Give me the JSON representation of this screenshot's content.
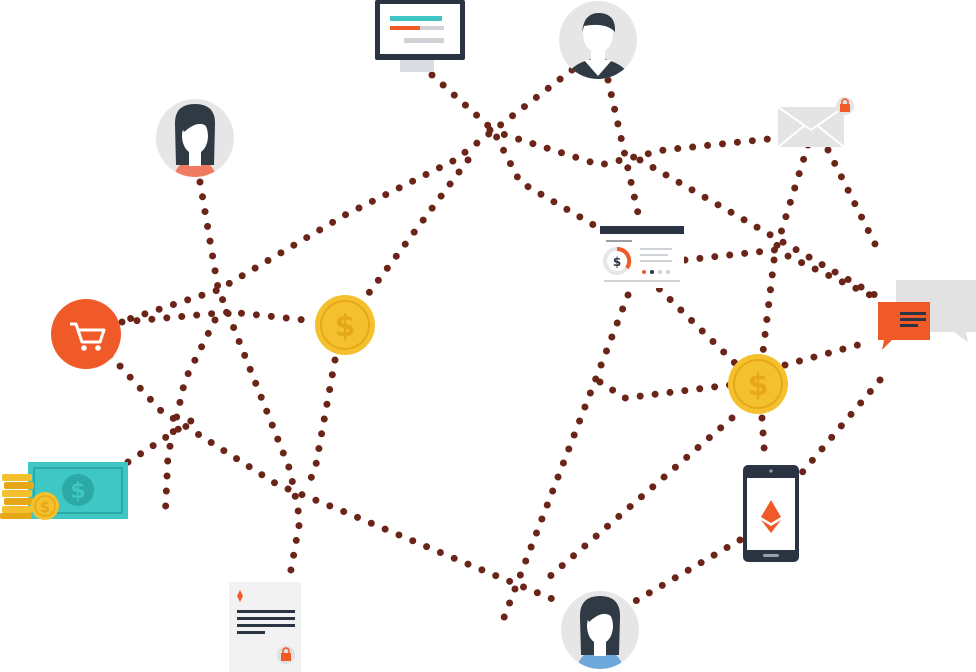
{
  "colors": {
    "dots": "#6b2418",
    "coin_gold": "#f5c02e",
    "coin_gold_dark": "#e6a817",
    "cart_orange": "#f05a28",
    "avatar_bg": "#e6e6e6",
    "hair": "#2f3a45",
    "skin": "#ffffff",
    "cash_teal": "#3fc7c5",
    "dark_navy": "#2b3443",
    "chat_grey": "#e2e2e2",
    "accent_orange": "#f05a28"
  },
  "icons": {
    "computer_monitor": "computer-monitor-icon",
    "user_top": "user-avatar-icon",
    "user_left": "user-avatar-icon",
    "user_bottom": "user-avatar-icon",
    "locked_mail": "locked-mail-icon",
    "shopping_cart": "shopping-cart-icon",
    "dollar_coin": "dollar-coin-icon",
    "report_document": "report-document-icon",
    "chat_bubble": "chat-bubble-icon",
    "cash_money": "cash-money-icon",
    "smartphone_ether": "smartphone-ether-icon",
    "locked_document": "locked-document-icon"
  }
}
